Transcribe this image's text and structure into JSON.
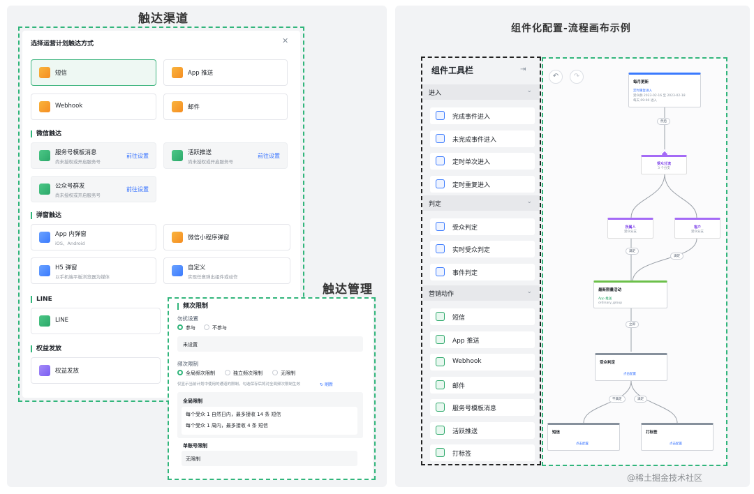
{
  "left": {
    "title": "触达渠道",
    "modal_title": "选择运营计划触达方式",
    "close_icon": "close-icon",
    "channels": [
      {
        "label": "短信",
        "icon": "sms-icon"
      },
      {
        "label": "App 推送",
        "icon": "app-push-icon"
      },
      {
        "label": "Webhook",
        "icon": "webhook-icon"
      },
      {
        "label": "邮件",
        "icon": "mail-icon"
      }
    ],
    "wechat_section": "微信触达",
    "wechat": [
      {
        "label": "服务号模板消息",
        "sub": "尚未授权或开启服务号",
        "action": "前往设置"
      },
      {
        "label": "活跃推送",
        "sub": "尚未授权或开启服务号",
        "action": "前往设置"
      },
      {
        "label": "公众号群发",
        "sub": "尚未授权或开启服务号",
        "action": "前往设置"
      }
    ],
    "popup_section": "弹窗触达",
    "popup": [
      {
        "label": "App 内弹窗",
        "sub": "iOS、Android"
      },
      {
        "label": "微信小程序弹窗",
        "sub": ""
      },
      {
        "label": "H5 弹窗",
        "sub": "以手机端平板浏览器为媒体"
      },
      {
        "label": "自定义",
        "sub": "实现任意弹出组件或动作"
      }
    ],
    "line_section": "LINE",
    "line_label": "LINE",
    "rights_section": "权益发放",
    "rights_label": "权益发放"
  },
  "manage": {
    "title": "触达管理",
    "freq_title": "频次限制",
    "dnd_label": "勿扰设置",
    "dnd_options": [
      "参与",
      "不参与"
    ],
    "dnd_value": "未设置",
    "times_label": "频次限制",
    "times_options": [
      "全局频次限制",
      "独立频次限制",
      "无限制"
    ],
    "hint": "仅显示当前计划中使用的通道的限制，勾选保存后将对全局频次限制生效",
    "refresh": "刷新",
    "global_label": "全局限制",
    "global_rules": [
      "每个受众 1 自然日内，最多接收 14 条 短信",
      "每个受众 1 周内，最多接收 4 条 短信"
    ],
    "account_label": "单账号限制",
    "account_value": "无限制"
  },
  "right": {
    "title": "组件化配置-流程画布示例",
    "toolbar_title": "组件工具栏",
    "groups": [
      {
        "label": "进入",
        "items": [
          "完成事件进入",
          "未完成事件进入",
          "定时单次进入",
          "定时重复进入"
        ]
      },
      {
        "label": "判定",
        "items": [
          "受众判定",
          "实时受众判定",
          "事件判定"
        ]
      },
      {
        "label": "营销动作",
        "items": [
          "短信",
          "App 推送",
          "Webhook",
          "邮件",
          "服务号模板消息",
          "活跃推送",
          "打标签"
        ]
      }
    ],
    "flow": {
      "start_title": "每月更新",
      "start_link": "定时重复进入",
      "start_lines": [
        "受众群 2023-02-16 至 2023-02-18",
        "每天 09:00 进入"
      ],
      "pill_next": "然后",
      "split_title": "受众分流",
      "split_sub": "3 个分支",
      "branch_a_title": "所属人",
      "branch_a_sub": "受众分支",
      "branch_b_title": "客户",
      "branch_b_sub": "受众分支",
      "pill_a": "满足",
      "pill_b": "满足",
      "activity_title": "最新限量活动",
      "activity_link": "App 推送",
      "activity_sub": "ordinary_group",
      "pill_c": "立即",
      "judge_title": "受众判定",
      "judge_link": "点击配置",
      "pill_yes": "不满足",
      "pill_no": "满足",
      "end_a_title": "短信",
      "end_a_link": "点击配置",
      "end_b_title": "打标签",
      "end_b_link": "点击配置"
    },
    "watermark": "@稀土掘金技术社区"
  }
}
